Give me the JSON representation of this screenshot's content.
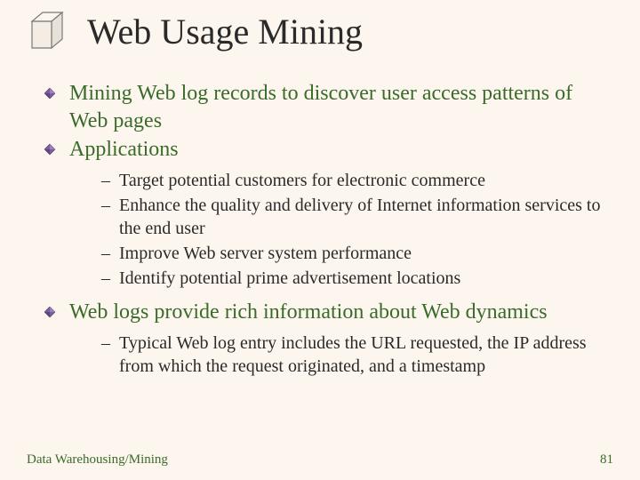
{
  "title": "Web Usage Mining",
  "bullets": [
    {
      "text": "Mining Web log records to discover user access patterns of Web pages",
      "subs": []
    },
    {
      "text": "Applications",
      "subs": [
        "Target potential customers for electronic commerce",
        "Enhance the quality and delivery of Internet information services to the end user",
        "Improve Web server system performance",
        "Identify potential prime advertisement locations"
      ]
    },
    {
      "text": "Web logs provide rich information about Web dynamics",
      "subs": [
        "Typical Web log entry includes the URL requested, the IP address from which the request originated, and a timestamp"
      ]
    }
  ],
  "footer": {
    "left": "Data Warehousing/Mining",
    "right": "81"
  }
}
